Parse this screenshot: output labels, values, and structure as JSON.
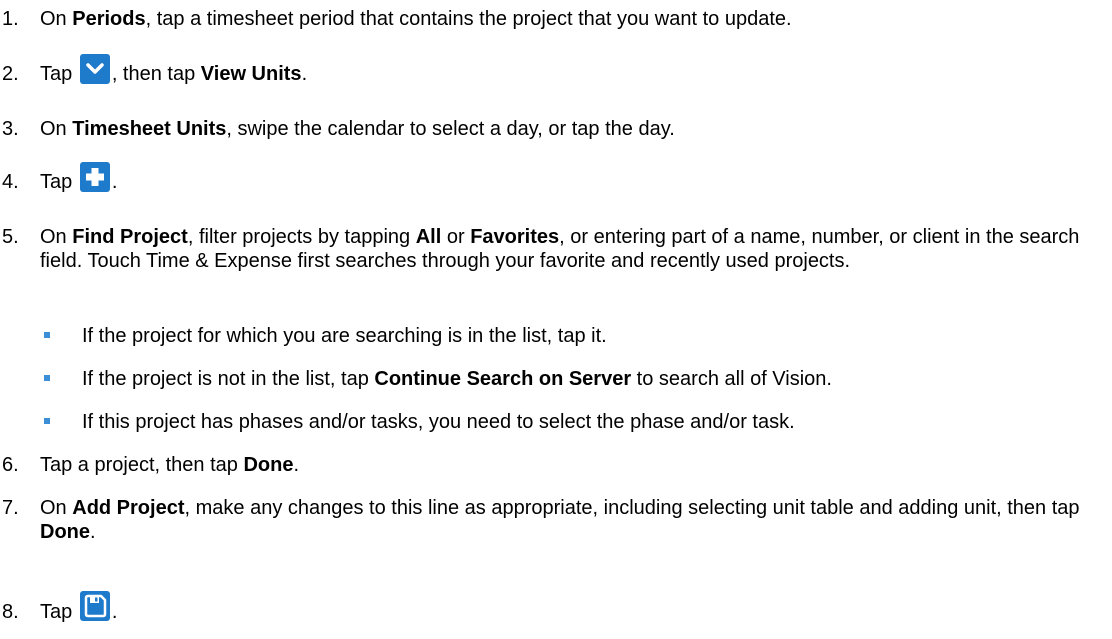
{
  "steps": [
    {
      "num": "1.",
      "p1": "On ",
      "b1": "Periods",
      "p2": ", tap a timesheet period that contains the project that you want to update."
    },
    {
      "num": "2.",
      "p1": "Tap ",
      "p2": ", then tap ",
      "b1": "View Units",
      "p3": "."
    },
    {
      "num": "3.",
      "p1": "On ",
      "b1": "Timesheet Units",
      "p2": ", swipe the calendar to select a day, or tap the day."
    },
    {
      "num": "4.",
      "p1": "Tap ",
      "p2": "."
    },
    {
      "num": "5.",
      "p1": "On ",
      "b1": "Find Project",
      "p2": ", filter projects by tapping ",
      "b2": "All",
      "p3": " or ",
      "b3": "Favorites",
      "p4": ", or entering part of a name, number, or client in the search field. Touch Time & Expense first searches through your favorite and recently used projects."
    },
    {
      "num": "6.",
      "p1": "Tap a project, then tap ",
      "b1": "Done",
      "p2": "."
    },
    {
      "num": "7.",
      "p1": "On ",
      "b1": "Add Project",
      "p2": ", make any changes to this line as appropriate, including selecting unit table and adding unit, then tap ",
      "b2": "Done",
      "p3": "."
    },
    {
      "num": "8.",
      "p1": "Tap ",
      "p2": "."
    }
  ],
  "bullets": [
    {
      "text": "If the project for which you are searching is in the list, tap it."
    },
    {
      "p1": "If the project is not in the list, tap ",
      "b1": "Continue Search on Server",
      "p2": " to search all of Vision."
    },
    {
      "text": "If this project has phases and/or tasks, you need to select the phase and/or task."
    }
  ],
  "icons": {
    "chevron": "chevron-down-icon",
    "add": "plus-icon",
    "save": "save-icon",
    "accent_color": "#1e7bcb",
    "bullet_color": "#3a8fd6"
  }
}
